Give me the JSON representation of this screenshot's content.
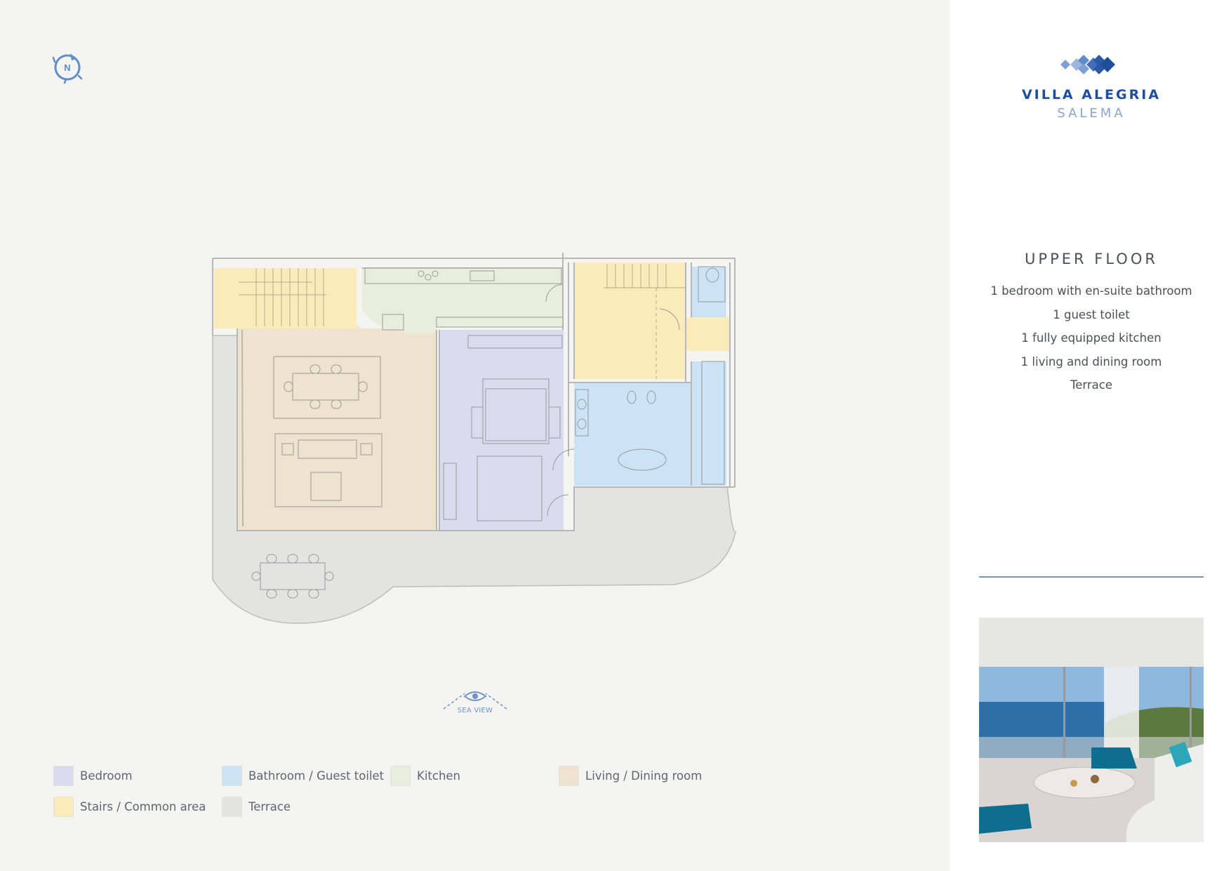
{
  "brand": {
    "name": "VILLA ALEGRIA",
    "subtitle": "SALEMA"
  },
  "floor": {
    "title": "UPPER FLOOR",
    "features": [
      "1 bedroom with en-suite bathroom",
      "1 guest toilet",
      "1 fully equipped kitchen",
      "1 living and dining room",
      "Terrace"
    ]
  },
  "compass": {
    "label": "N"
  },
  "sea_view": {
    "label": "SEA VIEW"
  },
  "legend": [
    {
      "label": "Bedroom",
      "color": "#d8dcee"
    },
    {
      "label": "Bathroom / Guest toilet",
      "color": "#cbe3f4"
    },
    {
      "label": "Kitchen",
      "color": "#e8eedb"
    },
    {
      "label": "Living / Dining room",
      "color": "#eee3cf"
    },
    {
      "label": "Stairs / Common area",
      "color": "#faebba"
    },
    {
      "label": "Terrace",
      "color": "#e3e3e2"
    }
  ],
  "colors": {
    "accent": "#1f4e9b",
    "accent_light": "#8aa5cf",
    "wall": "#b7b7b7",
    "furniture": "#9a9a9a"
  }
}
